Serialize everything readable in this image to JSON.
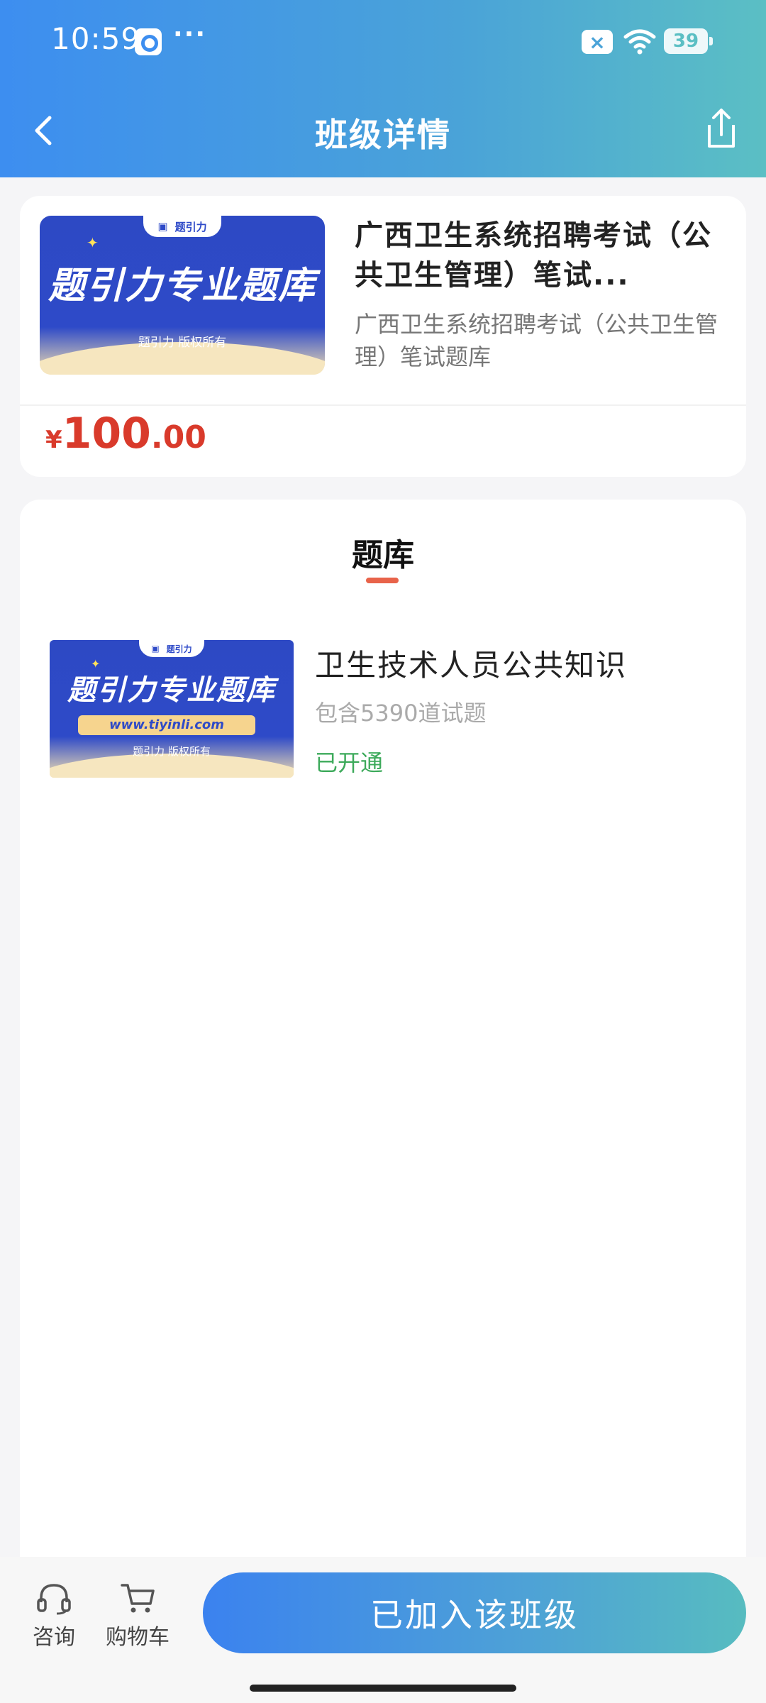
{
  "status_bar": {
    "time": "10:59",
    "dots": "···",
    "battery": "39"
  },
  "nav": {
    "title": "班级详情",
    "back_icon": "chevron-left-icon",
    "share_icon": "share-icon"
  },
  "course": {
    "cover": {
      "tab": "题引力",
      "title": "题引力专业题库",
      "copyright": "题引力 版权所有"
    },
    "title": "广西卫生系统招聘考试（公共卫生管理）笔试...",
    "subtitle": "广西卫生系统招聘考试（公共卫生管理）笔试题库",
    "price": {
      "symbol": "¥",
      "integer": "100",
      "decimal": ".00"
    }
  },
  "bank_section": {
    "title": "题库",
    "items": [
      {
        "cover": {
          "tab": "题引力",
          "title": "题引力专业题库",
          "url": "www.tiyinli.com",
          "copyright": "题引力 版权所有"
        },
        "name": "卫生技术人员公共知识",
        "count": "包含5390道试题",
        "status": "已开通"
      }
    ]
  },
  "bottom_bar": {
    "consult_label": "咨询",
    "cart_label": "购物车",
    "join_label": "已加入该班级"
  },
  "colors": {
    "header_gradient_start": "#3d8ef0",
    "header_gradient_end": "#5bbfc4",
    "price_red": "#d93a2b",
    "status_green": "#3daa5b",
    "underline_accent": "#e8634a"
  }
}
